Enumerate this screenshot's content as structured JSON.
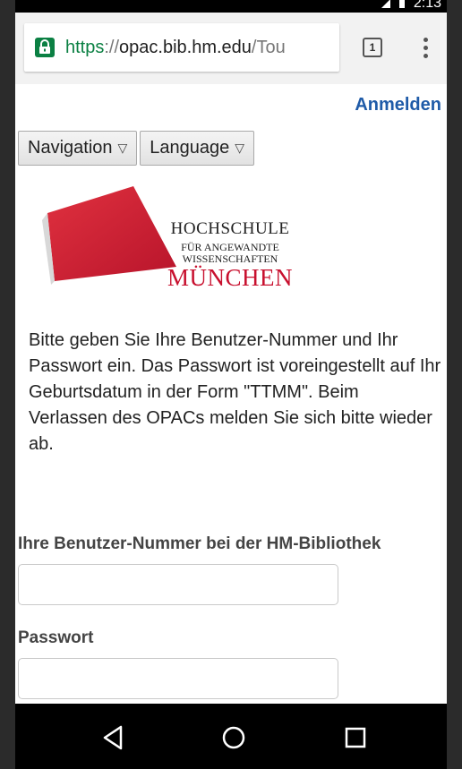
{
  "status_bar": {
    "time": "2:13"
  },
  "browser": {
    "url_scheme": "https",
    "url_separator": "://",
    "url_host": "opac.bib.hm.edu",
    "url_path": "/Tou",
    "tab_count": "1"
  },
  "page": {
    "login_link": "Anmelden",
    "nav_label": "Navigation",
    "lang_label": "Language",
    "logo": {
      "line1": "HOCHSCHULE",
      "line2": "FÜR ANGEWANDTE",
      "line3": "WISSENSCHAFTEN",
      "line4": "MÜNCHEN"
    },
    "intro_text": "Bitte geben Sie Ihre Benutzer-Nummer und Ihr Passwort ein. Das Passwort ist voreingestellt auf Ihr Geburtsdatum in der Form \"TTMM\". Beim Verlassen des OPACs melden Sie sich bitte wieder ab.",
    "user_label": "Ihre Benutzer-Nummer bei der HM-Bibliothek",
    "user_value": "",
    "password_label": "Passwort",
    "password_value": ""
  },
  "colors": {
    "link": "#1f5ba8",
    "secure_green": "#0b8043",
    "brand_red": "#c8102e"
  }
}
